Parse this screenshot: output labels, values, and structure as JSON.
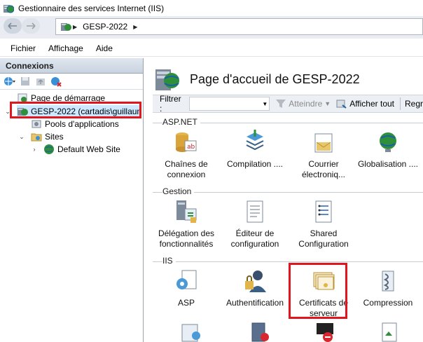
{
  "window": {
    "title": "Gestionnaire des services Internet (IIS)"
  },
  "address": {
    "segments": [
      "GESP-2022"
    ]
  },
  "menu": {
    "items": [
      "Fichier",
      "Affichage",
      "Aide"
    ]
  },
  "connections": {
    "header": "Connexions",
    "tree": [
      {
        "label": "Page de démarrage"
      },
      {
        "label": "GESP-2022 (cartadis\\guillaum"
      },
      {
        "label": "Pools d'applications"
      },
      {
        "label": "Sites"
      },
      {
        "label": "Default Web Site"
      }
    ]
  },
  "main": {
    "title": "Page d'accueil de GESP-2022",
    "filter": {
      "label": "Filtrer :",
      "go_label": "Atteindre",
      "show_all_label": "Afficher tout",
      "group_label": "Regr"
    },
    "groups": [
      {
        "name": "ASP.NET",
        "features": [
          {
            "line1": "Chaînes de",
            "line2": "connexion"
          },
          {
            "line1": "Compilation ....",
            "line2": ""
          },
          {
            "line1": "Courrier",
            "line2": "électroniq..."
          },
          {
            "line1": "Globalisation ....",
            "line2": ""
          }
        ]
      },
      {
        "name": "Gestion",
        "features": [
          {
            "line1": "Délégation des",
            "line2": "fonctionnalités"
          },
          {
            "line1": "Éditeur de",
            "line2": "configuration"
          },
          {
            "line1": "Shared",
            "line2": "Configuration"
          }
        ]
      },
      {
        "name": "IIS",
        "features": [
          {
            "line1": "ASP",
            "line2": ""
          },
          {
            "line1": "Authentification",
            "line2": ""
          },
          {
            "line1": "Certificats de",
            "line2": "serveur"
          },
          {
            "line1": "Compression",
            "line2": ""
          }
        ]
      }
    ]
  }
}
